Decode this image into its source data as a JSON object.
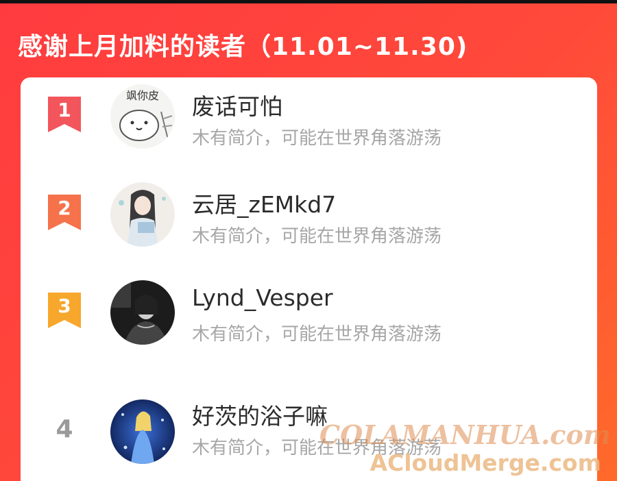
{
  "header": {
    "title": "感谢上月加料的读者（11.01~11.30)"
  },
  "readers": [
    {
      "rank": "1",
      "name": "废话可怕",
      "bio": "木有简介，可能在世界角落游荡",
      "badge_color": "#f2555b",
      "avatar_text": "飒你皮"
    },
    {
      "rank": "2",
      "name": "云居_zEMkd7",
      "bio": "木有简介，可能在世界角落游荡",
      "badge_color": "#f5724a",
      "avatar_text": ""
    },
    {
      "rank": "3",
      "name": "Lynd_Vesper",
      "bio": "木有简介，可能在世界角落游荡",
      "badge_color": "#f7a72c",
      "avatar_text": ""
    },
    {
      "rank": "4",
      "name": "好茨的浴子嘛",
      "bio": "木有简介，可能在世界角落游荡",
      "badge_color": "",
      "avatar_text": ""
    }
  ],
  "watermark": {
    "line1": "COLAMANHUA.com",
    "line2": "ACloudMerge.com"
  }
}
